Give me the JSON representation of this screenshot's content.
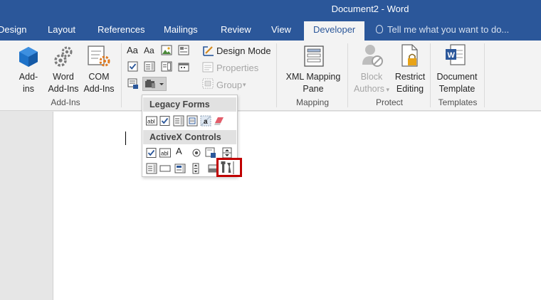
{
  "window": {
    "title": "Document2 - Word"
  },
  "tabs": [
    {
      "label": "Design"
    },
    {
      "label": "Layout"
    },
    {
      "label": "References"
    },
    {
      "label": "Mailings"
    },
    {
      "label": "Review"
    },
    {
      "label": "View"
    },
    {
      "label": "Developer",
      "active": true
    }
  ],
  "tell_me": {
    "placeholder": "Tell me what you want to do..."
  },
  "ribbon": {
    "addins": {
      "group_label": "Add-Ins",
      "addins_line1": "Add-",
      "addins_line2": "ins",
      "word_addins_line1": "Word",
      "word_addins_line2": "Add-Ins",
      "com_addins_line1": "COM",
      "com_addins_line2": "Add-Ins"
    },
    "controls": {
      "design_mode": "Design Mode",
      "properties": "Properties",
      "group": "Group",
      "aa1": "Aa",
      "aa2": "Aa"
    },
    "mapping": {
      "group_label": "Mapping",
      "xml_line1": "XML Mapping",
      "xml_line2": "Pane"
    },
    "protect": {
      "group_label": "Protect",
      "block_line1": "Block",
      "block_line2": "Authors",
      "restrict_line1": "Restrict",
      "restrict_line2": "Editing"
    },
    "templates": {
      "group_label": "Templates",
      "doc_template_line1": "Document",
      "doc_template_line2": "Template"
    }
  },
  "dropdown": {
    "legacy_header": "Legacy Forms",
    "activex_header": "ActiveX Controls",
    "legacy_text_field": "abl",
    "legacy_frame_letter": "a",
    "activex_text_box": "abl",
    "activex_label": "A"
  },
  "colors": {
    "accent": "#2b579a",
    "highlight": "#c00000",
    "check_blue": "#2b579a",
    "addins_icon": "#1e72c8",
    "com_orange": "#e07a20",
    "word_blue": "#2b579a"
  }
}
